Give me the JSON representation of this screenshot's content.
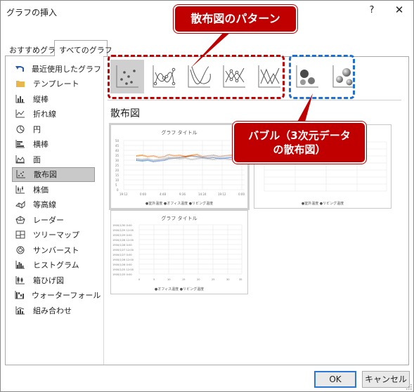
{
  "dialog": {
    "title": "グラフの挿入",
    "help": "?",
    "close": "✕"
  },
  "tabs": [
    {
      "label": "おすすめグラフ"
    },
    {
      "label": "すべてのグラフ"
    }
  ],
  "sidebar": {
    "items": [
      {
        "label": "最近使用したグラフ",
        "icon": "undo-icon"
      },
      {
        "label": "テンプレート",
        "icon": "folder-icon"
      },
      {
        "label": "縦棒",
        "icon": "column-chart-icon"
      },
      {
        "label": "折れ線",
        "icon": "line-chart-icon"
      },
      {
        "label": "円",
        "icon": "pie-chart-icon"
      },
      {
        "label": "横棒",
        "icon": "bar-chart-icon"
      },
      {
        "label": "面",
        "icon": "area-chart-icon"
      },
      {
        "label": "散布図",
        "icon": "scatter-chart-icon",
        "selected": true
      },
      {
        "label": "株価",
        "icon": "stock-chart-icon"
      },
      {
        "label": "等高線",
        "icon": "surface-chart-icon"
      },
      {
        "label": "レーダー",
        "icon": "radar-chart-icon"
      },
      {
        "label": "ツリーマップ",
        "icon": "treemap-icon"
      },
      {
        "label": "サンバースト",
        "icon": "sunburst-icon"
      },
      {
        "label": "ヒストグラム",
        "icon": "histogram-icon"
      },
      {
        "label": "箱ひげ図",
        "icon": "box-whisker-icon"
      },
      {
        "label": "ウォーターフォール",
        "icon": "waterfall-icon"
      },
      {
        "label": "組み合わせ",
        "icon": "combo-chart-icon"
      }
    ]
  },
  "chart_types": [
    {
      "icon": "scatter-markers-icon",
      "selected": true
    },
    {
      "icon": "scatter-smooth-lines-markers-icon"
    },
    {
      "icon": "scatter-smooth-lines-icon"
    },
    {
      "icon": "scatter-straight-lines-markers-icon"
    },
    {
      "icon": "scatter-straight-lines-icon"
    },
    {
      "icon": "bubble-icon"
    },
    {
      "icon": "bubble-3d-icon"
    }
  ],
  "section_title": "散布図",
  "previews": {
    "p1": {
      "title": "グラフ タイトル",
      "legend": "●室外温度  ●オフィス温度  ●リビング温度",
      "y_ticks": [
        "50",
        "45",
        "40",
        "35",
        "30",
        "25",
        "20",
        "15",
        "10",
        "5",
        "0"
      ],
      "x_ticks": [
        "19:12",
        "0:00",
        "4:48",
        "9:36",
        "14:24",
        "19:12",
        "0:00"
      ]
    },
    "p2": {
      "legend": "●室外温度  ●リビング温度"
    },
    "p3": {
      "title": "グラフ タイトル",
      "legend": "●オフィス温度  ●リビング温度",
      "y_ticks": [
        "1900/1/30 0:00",
        "1900/1/29 12:00",
        "1900/1/29 0:00",
        "1900/1/28 12:00",
        "1900/1/28 0:00",
        "1900/1/27 12:00",
        "1900/1/27 0:00",
        "1900/1/26 12:00",
        "1900/1/26 0:00",
        "1900/1/25 12:00",
        "1900/1/25 0:00"
      ],
      "x_ticks": [
        "0",
        "5",
        "10",
        "15",
        "20",
        "25",
        "30",
        "35"
      ]
    }
  },
  "callouts": {
    "pattern": "散布図のパターン",
    "bubble_line1": "バブル（3次元データ",
    "bubble_line2": "の散布図）"
  },
  "buttons": {
    "ok": "OK",
    "cancel": "キャンセル"
  },
  "colors": {
    "accent_red": "#c00000",
    "accent_blue": "#1f6fd0",
    "series_blue": "#4472c4",
    "series_orange": "#ed7d31",
    "series_gray": "#a5a5a5"
  }
}
